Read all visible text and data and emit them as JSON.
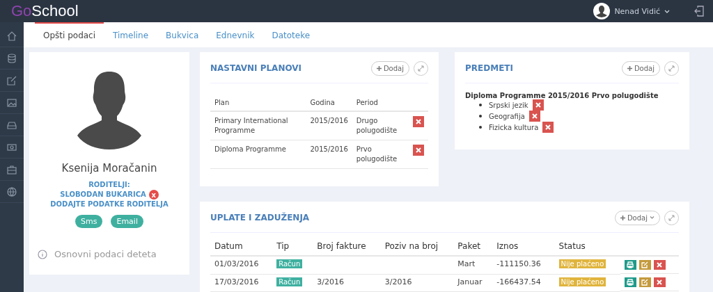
{
  "app": {
    "logo_first": "Go",
    "logo_second": "School"
  },
  "user": {
    "name": "Nenad Vidić"
  },
  "tabs": [
    {
      "label": "Opšti podaci",
      "selected": true
    },
    {
      "label": "Timeline",
      "selected": false
    },
    {
      "label": "Bukvica",
      "selected": false
    },
    {
      "label": "Ednevnik",
      "selected": false
    },
    {
      "label": "Datoteke",
      "selected": false
    }
  ],
  "profile": {
    "name": "Ksenija Moračanin",
    "parents_label": "RODITELJI:",
    "parent": "SLOBODAN BUKARICA",
    "remove_mark": "x",
    "add_parent": "DODAJTE PODATKE RODITELJA",
    "buttons": [
      "Sms",
      "Email"
    ],
    "info": "Osnovni podaci deteta"
  },
  "plans": {
    "title": "NASTAVNI PLANOVI",
    "add": "Dodaj",
    "columns": [
      "Plan",
      "Godina",
      "Period"
    ],
    "rows": [
      [
        "Primary International Programme",
        "2015/2016",
        "Drugo polugodište"
      ],
      [
        "Diploma Programme",
        "2015/2016",
        "Prvo polugodište"
      ]
    ]
  },
  "subjects": {
    "title": "PREDMETI",
    "add": "Dodaj",
    "group": "Diploma Programme 2015/2016 Prvo polugodište",
    "items": [
      "Srpski jezik",
      "Geografija",
      "Fizicka kultura"
    ]
  },
  "payments": {
    "title": "UPLATE I ZADUŽENJA",
    "add": "Dodaj",
    "columns": [
      "Datum",
      "Tip",
      "Broj fakture",
      "Poziv na broj",
      "Paket",
      "Iznos",
      "Status"
    ],
    "rows": [
      {
        "date": "01/03/2016",
        "type": "Račun",
        "invoice": "",
        "reference": "",
        "package": "Mart",
        "amount": "-111150.36",
        "status": "Nije plaćeno"
      },
      {
        "date": "17/03/2016",
        "type": "Račun",
        "invoice": "3/2016",
        "reference": "3/2016",
        "package": "Januar",
        "amount": "-166437.54",
        "status": "Nije plaćeno"
      }
    ]
  }
}
